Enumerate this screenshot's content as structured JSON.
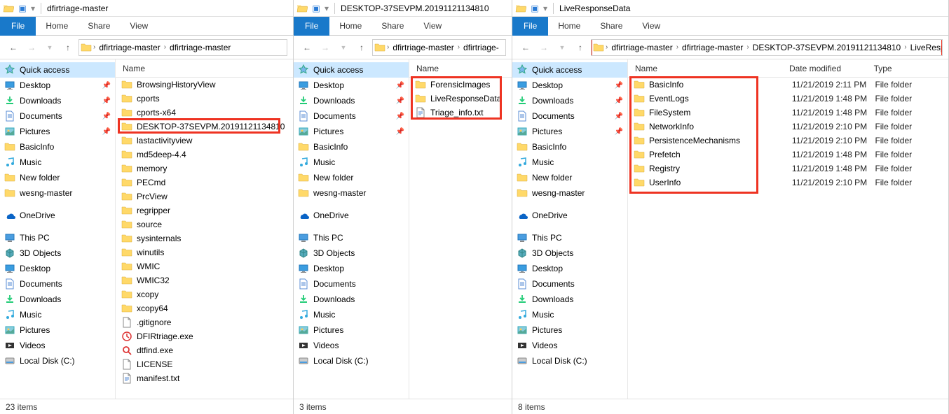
{
  "windows": [
    {
      "title": "dfirtriage-master",
      "tabs": {
        "file": "File",
        "home": "Home",
        "share": "Share",
        "view": "View"
      },
      "crumbs": [
        "dfirtriage-master",
        "dfirtriage-master"
      ],
      "cols": {
        "name": "Name"
      },
      "sidebar": {
        "qa": "Quick access",
        "desktop": "Desktop",
        "downloads": "Downloads",
        "documents": "Documents",
        "pictures": "Pictures",
        "basicinfo": "BasicInfo",
        "music": "Music",
        "newfolder": "New folder",
        "wesng": "wesng-master",
        "onedrive": "OneDrive",
        "thispc": "This PC",
        "3d": "3D Objects",
        "desk2": "Desktop",
        "docs2": "Documents",
        "dl2": "Downloads",
        "music2": "Music",
        "pics2": "Pictures",
        "videos": "Videos",
        "local": "Local Disk (C:)"
      },
      "files": [
        {
          "n": "BrowsingHistoryView",
          "t": "folder"
        },
        {
          "n": "cports",
          "t": "folder"
        },
        {
          "n": "cports-x64",
          "t": "folder"
        },
        {
          "n": "DESKTOP-37SEVPM.20191121134810",
          "t": "folder",
          "hl": true
        },
        {
          "n": "lastactivityview",
          "t": "folder"
        },
        {
          "n": "md5deep-4.4",
          "t": "folder"
        },
        {
          "n": "memory",
          "t": "folder"
        },
        {
          "n": "PECmd",
          "t": "folder"
        },
        {
          "n": "PrcView",
          "t": "folder"
        },
        {
          "n": "regripper",
          "t": "folder"
        },
        {
          "n": "source",
          "t": "folder"
        },
        {
          "n": "sysinternals",
          "t": "folder"
        },
        {
          "n": "winutils",
          "t": "folder"
        },
        {
          "n": "WMIC",
          "t": "folder"
        },
        {
          "n": "WMIC32",
          "t": "folder"
        },
        {
          "n": "xcopy",
          "t": "folder"
        },
        {
          "n": "xcopy64",
          "t": "folder"
        },
        {
          "n": ".gitignore",
          "t": "file"
        },
        {
          "n": "DFIRtriage.exe",
          "t": "exe-red"
        },
        {
          "n": "dtfind.exe",
          "t": "exe-search"
        },
        {
          "n": "LICENSE",
          "t": "file"
        },
        {
          "n": "manifest.txt",
          "t": "txt"
        }
      ],
      "status": "23 items"
    },
    {
      "title": "DESKTOP-37SEVPM.20191121134810",
      "tabs": {
        "file": "File",
        "home": "Home",
        "share": "Share",
        "view": "View"
      },
      "crumbs": [
        "dfirtriage-master",
        "dfirtriage-"
      ],
      "cols": {
        "name": "Name"
      },
      "sidebar": {
        "qa": "Quick access",
        "desktop": "Desktop",
        "downloads": "Downloads",
        "documents": "Documents",
        "pictures": "Pictures",
        "basicinfo": "BasicInfo",
        "music": "Music",
        "newfolder": "New folder",
        "wesng": "wesng-master",
        "onedrive": "OneDrive",
        "thispc": "This PC",
        "3d": "3D Objects",
        "desk2": "Desktop",
        "docs2": "Documents",
        "dl2": "Downloads",
        "music2": "Music",
        "pics2": "Pictures",
        "videos": "Videos",
        "local": "Local Disk (C:)"
      },
      "files": [
        {
          "n": "ForensicImages",
          "t": "folder",
          "hl": true
        },
        {
          "n": "LiveResponseData",
          "t": "folder",
          "hl": true
        },
        {
          "n": "Triage_info.txt",
          "t": "txt",
          "hl": true
        }
      ],
      "status": "3 items"
    },
    {
      "title": "LiveResponseData",
      "tabs": {
        "file": "File",
        "home": "Home",
        "share": "Share",
        "view": "View"
      },
      "crumbs": [
        "dfirtriage-master",
        "dfirtriage-master",
        "DESKTOP-37SEVPM.20191121134810",
        "LiveResp"
      ],
      "crumbsHl": true,
      "cols": {
        "name": "Name",
        "date": "Date modified",
        "type": "Type"
      },
      "sidebar": {
        "qa": "Quick access",
        "desktop": "Desktop",
        "downloads": "Downloads",
        "documents": "Documents",
        "pictures": "Pictures",
        "basicinfo": "BasicInfo",
        "music": "Music",
        "newfolder": "New folder",
        "wesng": "wesng-master",
        "onedrive": "OneDrive",
        "thispc": "This PC",
        "3d": "3D Objects",
        "desk2": "Desktop",
        "docs2": "Documents",
        "dl2": "Downloads",
        "music2": "Music",
        "pics2": "Pictures",
        "videos": "Videos",
        "local": "Local Disk (C:)"
      },
      "files": [
        {
          "n": "BasicInfo",
          "t": "folder",
          "d": "11/21/2019 2:11 PM",
          "ty": "File folder"
        },
        {
          "n": "EventLogs",
          "t": "folder",
          "d": "11/21/2019 1:48 PM",
          "ty": "File folder"
        },
        {
          "n": "FileSystem",
          "t": "folder",
          "d": "11/21/2019 1:48 PM",
          "ty": "File folder"
        },
        {
          "n": "NetworkInfo",
          "t": "folder",
          "d": "11/21/2019 2:10 PM",
          "ty": "File folder"
        },
        {
          "n": "PersistenceMechanisms",
          "t": "folder",
          "d": "11/21/2019 2:10 PM",
          "ty": "File folder"
        },
        {
          "n": "Prefetch",
          "t": "folder",
          "d": "11/21/2019 1:48 PM",
          "ty": "File folder"
        },
        {
          "n": "Registry",
          "t": "folder",
          "d": "11/21/2019 1:48 PM",
          "ty": "File folder"
        },
        {
          "n": "UserInfo",
          "t": "folder",
          "d": "11/21/2019 2:10 PM",
          "ty": "File folder"
        }
      ],
      "filesHl": true,
      "status": "8 items"
    }
  ]
}
